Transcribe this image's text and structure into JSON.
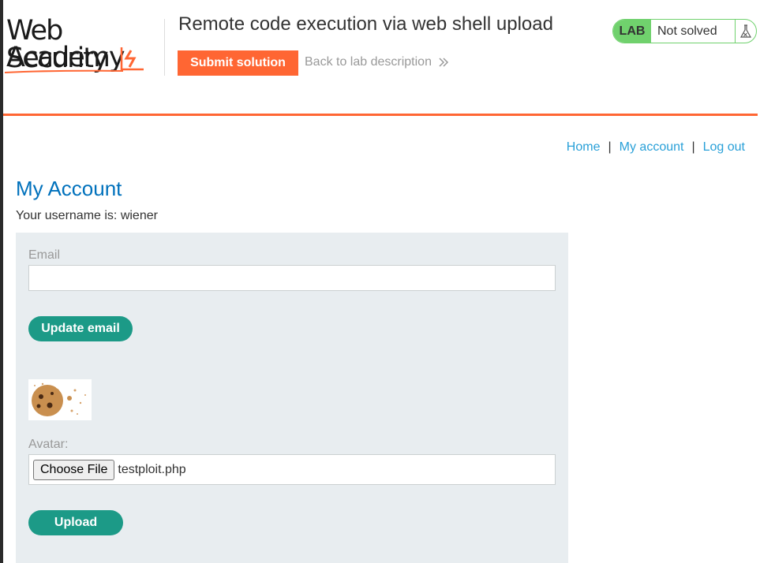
{
  "header": {
    "logo": {
      "line1": "Web Security",
      "line2": "Academy"
    },
    "lab_title": "Remote code execution via web shell upload",
    "submit_label": "Submit solution",
    "back_label": "Back to lab description",
    "back_icon": "double-chevron-right-icon",
    "lab_badge": {
      "tag": "LAB",
      "status": "Not solved",
      "icon": "flask-icon"
    }
  },
  "nav": {
    "home": "Home",
    "separator": "|",
    "my_account": "My account",
    "log_out": "Log out"
  },
  "main": {
    "title": "My Account",
    "username_line": "Your username is: wiener",
    "email_form": {
      "label": "Email",
      "value": "",
      "button": "Update email"
    },
    "avatar_form": {
      "label": "Avatar:",
      "choose_button": "Choose File",
      "file_name": "testploit.php",
      "button": "Upload"
    }
  },
  "colors": {
    "brand_orange": "#ff6633",
    "link_blue": "#29a0d8",
    "title_blue": "#0071bc",
    "button_teal": "#1c9a87",
    "lab_green": "#70d16d",
    "panel_bg": "#e8edf0"
  }
}
